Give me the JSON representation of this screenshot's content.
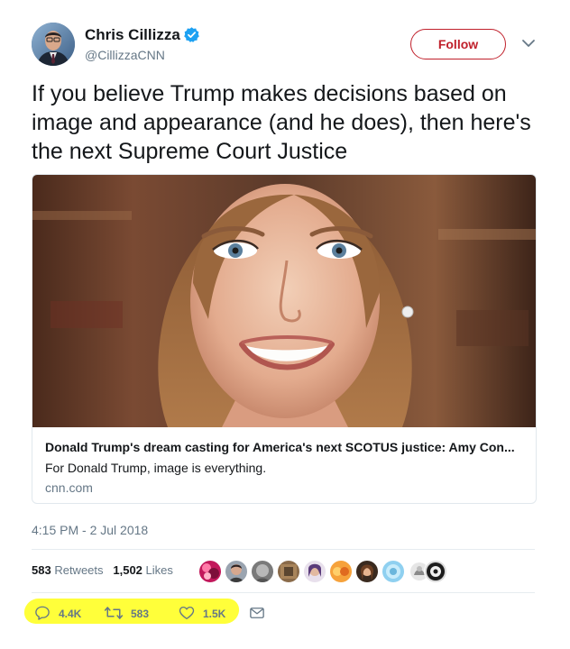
{
  "author": {
    "display_name": "Chris Cillizza",
    "handle": "@CillizzaCNN",
    "verified": true
  },
  "follow_button": {
    "label": "Follow",
    "color": "#c0202b"
  },
  "tweet": {
    "text": "If you believe Trump makes decisions based on image and appearance (and he does), then here's the next Supreme Court Justice"
  },
  "card": {
    "title": "Donald Trump's dream casting for America's next SCOTUS justice: Amy Con...",
    "description": "For Donald Trump, image is everything.",
    "domain": "cnn.com"
  },
  "timestamp": "4:15 PM - 2 Jul 2018",
  "stats": {
    "retweets_count": "583",
    "retweets_label": "Retweets",
    "likes_count": "1,502",
    "likes_label": "Likes"
  },
  "actions": {
    "reply_count": "4.4K",
    "retweet_count": "583",
    "like_count": "1.5K"
  },
  "highlight_color": "#ffff3a",
  "icons": [
    "verified-icon",
    "chevron-down-icon",
    "reply-icon",
    "retweet-icon",
    "heart-icon",
    "envelope-icon"
  ]
}
